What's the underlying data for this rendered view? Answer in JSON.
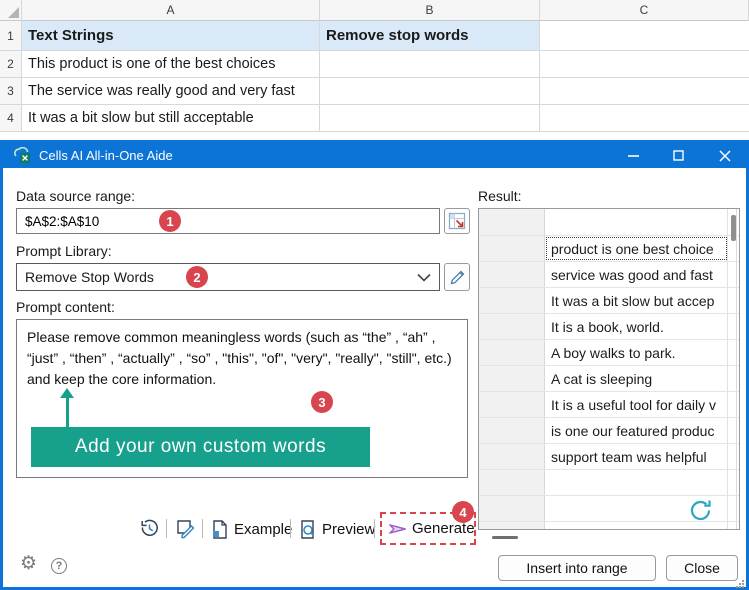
{
  "colors": {
    "titlebar_blue": "#0b74d6",
    "accent_teal": "#17a08c",
    "badge_red": "#d8454f",
    "generate_purple": "#a05fc8",
    "refresh_teal": "#2aa7bd",
    "header_row_fill": "#d9e9f8"
  },
  "spreadsheet": {
    "columns": [
      "A",
      "B",
      "C"
    ],
    "rows": [
      {
        "num": "1",
        "a": "Text Strings",
        "b": "Remove stop words",
        "c": ""
      },
      {
        "num": "2",
        "a": "This product is one of the best choices",
        "b": "",
        "c": ""
      },
      {
        "num": "3",
        "a": "The service was really good and very fast",
        "b": "",
        "c": ""
      },
      {
        "num": "4",
        "a": "It was a bit slow but still acceptable",
        "b": "",
        "c": ""
      }
    ]
  },
  "dialog": {
    "title": "Cells AI All-in-One Aide",
    "fields": {
      "data_source_label": "Data source range:",
      "data_source_value": "$A$2:$A$10",
      "prompt_library_label": "Prompt Library:",
      "prompt_library_value": "Remove Stop Words",
      "prompt_content_label": "Prompt content:",
      "prompt_text": "Please remove common meaningless words (such as “the” , “ah” , “just” , “then” , “actually” , “so” , \"this\", \"of\", \"very\", \"really\", \"still\", etc.) and keep the core information."
    },
    "annotation": {
      "callout_text": "Add your own custom words",
      "step_badges": [
        "1",
        "2",
        "3",
        "4"
      ]
    },
    "toolbar": {
      "example_label": "Example",
      "preview_label": "Preview",
      "generate_label": "Generate"
    },
    "result": {
      "label": "Result:",
      "rows": [
        "product is one best choice",
        "service was good and fast",
        "It was a bit slow but accep",
        "It is a book, world.",
        "A boy walks to park.",
        "A cat is sleeping",
        "It is a useful tool for daily v",
        "is one our featured produc",
        "support team was helpful"
      ]
    },
    "footer": {
      "insert_label": "Insert into range",
      "close_label": "Close",
      "settings_glyph": "⚙",
      "help_glyph": "?"
    }
  },
  "icons": {
    "titlebar": "excel-cells-icon",
    "range_picker": "range-picker-icon",
    "dropdown": "chevron-down-icon",
    "edit": "pencil-icon",
    "history": "history-clock-icon",
    "prompt_edit": "prompt-edit-icon",
    "example": "document-icon",
    "preview": "preview-magnifier-icon",
    "generate": "send-arrow-icon",
    "refresh": "refresh-icon",
    "settings": "gear-icon",
    "help": "help-icon"
  }
}
